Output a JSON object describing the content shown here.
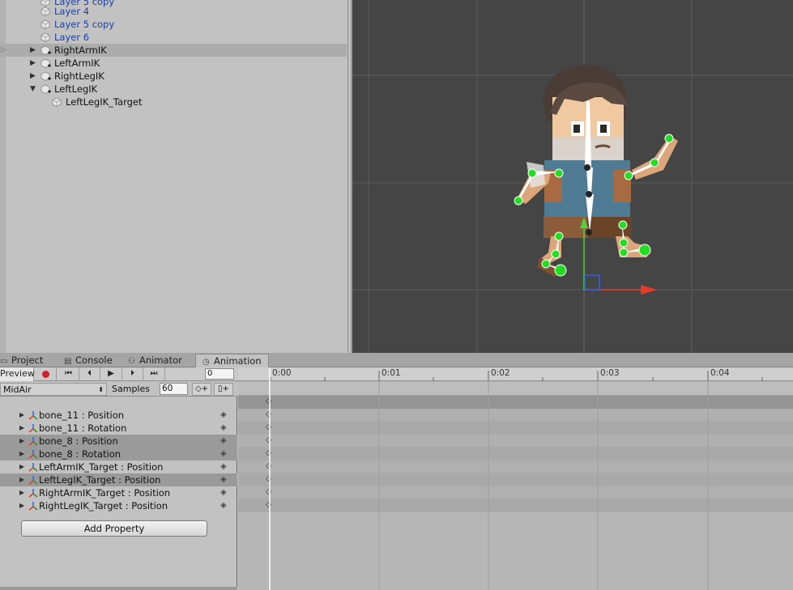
{
  "hierarchy": {
    "items": [
      {
        "label": "Layer 5 copy",
        "blue": true
      },
      {
        "label": "Layer 4",
        "blue": true
      },
      {
        "label": "Layer 5 copy",
        "blue": true
      },
      {
        "label": "Layer 6",
        "blue": true
      },
      {
        "label": "RightArmIK",
        "blue": false
      },
      {
        "label": "LeftArmIK",
        "blue": false
      },
      {
        "label": "RightLegIK",
        "blue": false
      },
      {
        "label": "LeftLegIK",
        "blue": false
      },
      {
        "label": "LeftLegIK_Target",
        "blue": false
      }
    ]
  },
  "tabs": [
    {
      "label": "Project",
      "icon": "folder-icon"
    },
    {
      "label": "Console",
      "icon": "console-icon"
    },
    {
      "label": "Animator",
      "icon": "animator-icon"
    },
    {
      "label": "Animation",
      "icon": "clock-icon"
    }
  ],
  "animation": {
    "preview_label": "Preview",
    "frame": "0",
    "clip": "MidAir",
    "samples_label": "Samples",
    "samples": "60",
    "add_property_label": "Add Property",
    "properties": [
      "bone_11 : Position",
      "bone_11 : Rotation",
      "bone_8 : Position",
      "bone_8 : Rotation",
      "LeftArmIK_Target : Position",
      "LeftLegIK_Target : Position",
      "RightArmIK_Target : Position",
      "RightLegIK_Target : Position"
    ],
    "ruler": [
      "0:00",
      "0:01",
      "0:02",
      "0:03",
      "0:04"
    ]
  },
  "colors": {
    "record": "#d0202a",
    "bone_joint": "#22dd22",
    "axis_x": "#e83a2a",
    "axis_y": "#52d23a",
    "axis_z": "#2f62e8"
  }
}
